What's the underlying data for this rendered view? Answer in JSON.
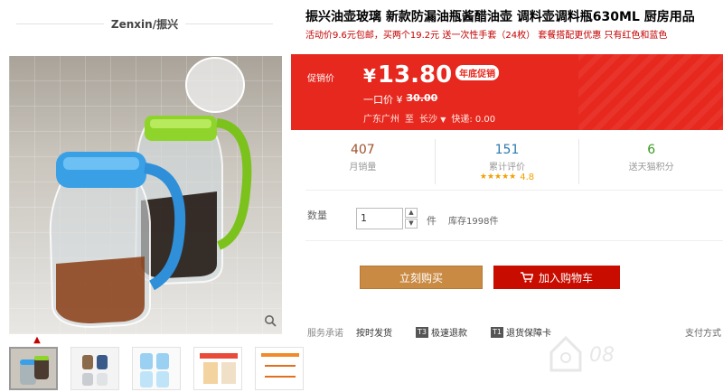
{
  "shop": {
    "name": "Zenxin/振兴"
  },
  "gallery": {
    "zoom_icon": "magnifier-icon",
    "up_icon": "chevron-up-icon",
    "thumbnail_count": 5
  },
  "product": {
    "title": "振兴油壶玻璃 新款防漏油瓶酱醋油壶 调料壶调料瓶630ML 厨房用品",
    "subtitle": "活动价9.6元包邮，买两个19.2元 送一次性手套（24枚） 套餐搭配更优惠 只有红色和蓝色"
  },
  "promo": {
    "label": "促销价",
    "currency": "¥",
    "price": "13.80",
    "badge": "年底促销",
    "orig_label": "一口价 ¥",
    "orig_price": "30.00",
    "ship_from": "广东广州",
    "ship_to_label": "至",
    "ship_to": "长沙",
    "ship_fee": "快递: 0.00",
    "bg_color": "#e7281e"
  },
  "stats": [
    {
      "value": "407",
      "label": "月销量",
      "color": "#a0522d"
    },
    {
      "value": "151",
      "label": "累计评价",
      "color": "#2a7ab0",
      "stars": "★★★★★",
      "score": "4.8"
    },
    {
      "value": "6",
      "label": "送天猫积分",
      "color": "#3a9a1e"
    }
  ],
  "quantity": {
    "label": "数量",
    "value": "1",
    "unit": "件",
    "stock": "库存1998件"
  },
  "buttons": {
    "buy": "立刻购买",
    "cart": "加入购物车"
  },
  "service": {
    "label": "服务承诺",
    "items": [
      {
        "tag": "",
        "text": "按时发货"
      },
      {
        "tag": "T3",
        "text": "极速退款"
      },
      {
        "tag": "T1",
        "text": "退货保障卡"
      }
    ],
    "pay": "支付方式"
  }
}
